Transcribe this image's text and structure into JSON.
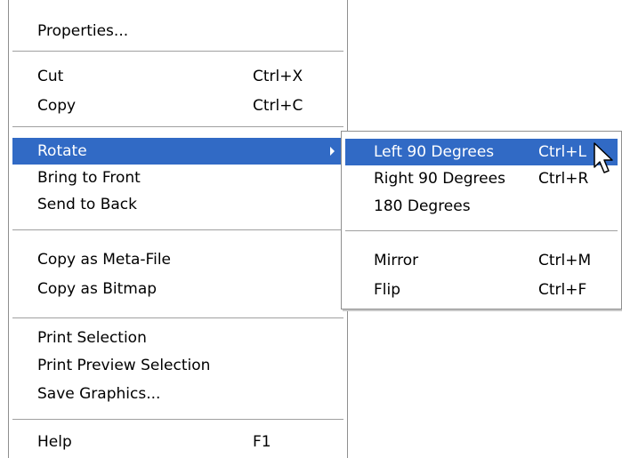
{
  "main_menu": {
    "properties": {
      "label": "Properties..."
    },
    "cut": {
      "label": "Cut",
      "shortcut": "Ctrl+X"
    },
    "copy": {
      "label": "Copy",
      "shortcut": "Ctrl+C"
    },
    "rotate": {
      "label": "Rotate"
    },
    "bring_to_front": {
      "label": "Bring to Front"
    },
    "send_to_back": {
      "label": "Send to Back"
    },
    "copy_meta": {
      "label": "Copy as Meta-File"
    },
    "copy_bitmap": {
      "label": "Copy as Bitmap"
    },
    "print_selection": {
      "label": "Print Selection"
    },
    "print_preview": {
      "label": "Print Preview Selection"
    },
    "save_graphics": {
      "label": "Save Graphics..."
    },
    "help": {
      "label": "Help",
      "shortcut": "F1"
    }
  },
  "rotate_submenu": {
    "left90": {
      "label": "Left 90 Degrees",
      "shortcut": "Ctrl+L"
    },
    "right90": {
      "label": "Right 90 Degrees",
      "shortcut": "Ctrl+R"
    },
    "deg180": {
      "label": "180 Degrees"
    },
    "mirror": {
      "label": "Mirror",
      "shortcut": "Ctrl+M"
    },
    "flip": {
      "label": "Flip",
      "shortcut": "Ctrl+F"
    }
  },
  "colors": {
    "highlight": "#316ac5",
    "highlight_text": "#ffffff",
    "border": "#8f8f8f",
    "separator": "#a0a0a0"
  },
  "icons": {
    "submenu_arrow": "submenu-arrow-icon",
    "cursor": "mouse-pointer-icon"
  }
}
